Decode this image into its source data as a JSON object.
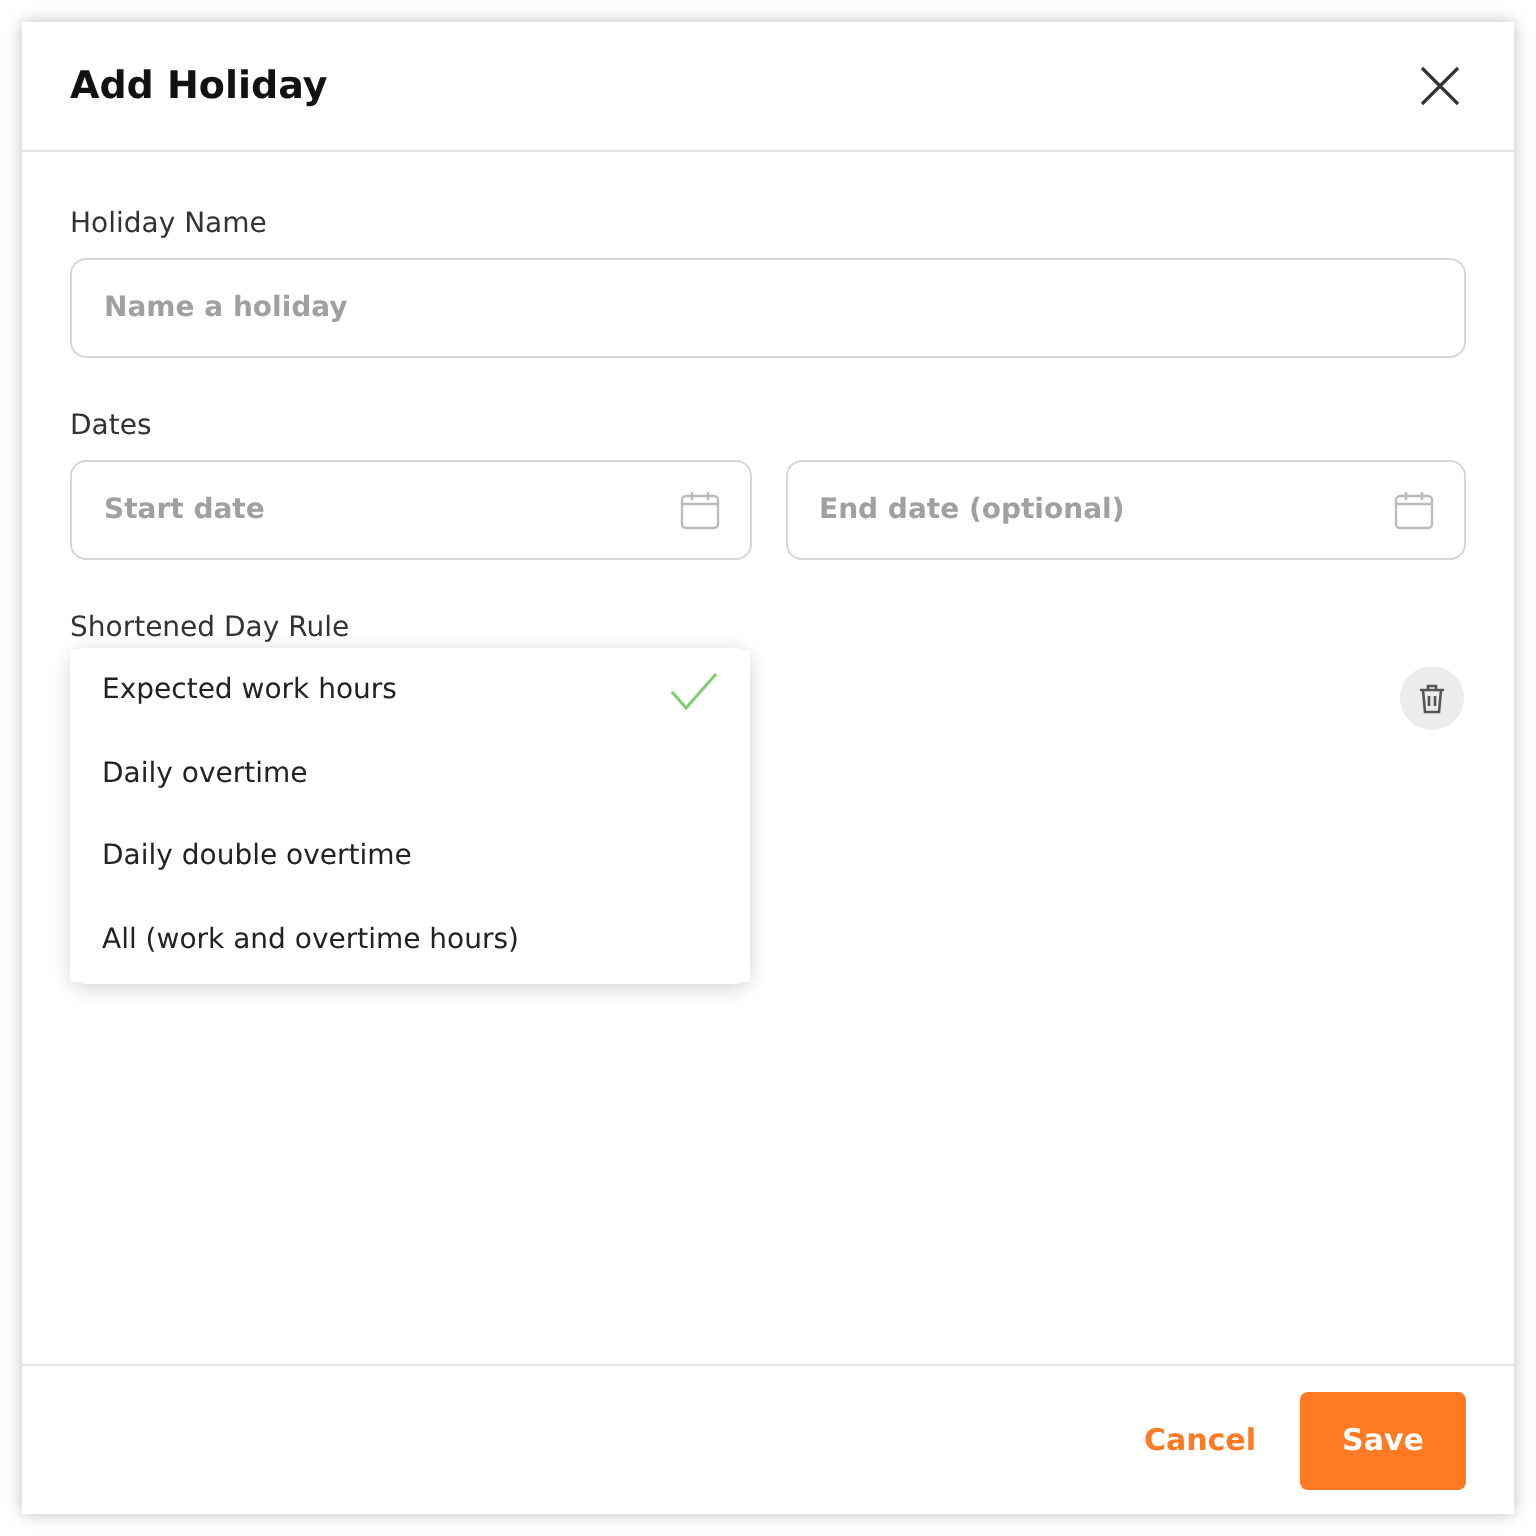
{
  "dialog": {
    "title": "Add Holiday"
  },
  "holiday_name": {
    "label": "Holiday Name",
    "placeholder": "Name a holiday"
  },
  "dates": {
    "label": "Dates",
    "start": {
      "placeholder": "Start date"
    },
    "end": {
      "placeholder": "End date (optional)"
    }
  },
  "shortened_day_rule": {
    "label": "Shortened Day Rule",
    "options": [
      {
        "label": "Expected work hours",
        "selected": true
      },
      {
        "label": "Daily overtime",
        "selected": false
      },
      {
        "label": "Daily double overtime",
        "selected": false
      },
      {
        "label": "All (work and overtime hours)",
        "selected": false
      }
    ]
  },
  "footer": {
    "cancel": "Cancel",
    "save": "Save"
  }
}
